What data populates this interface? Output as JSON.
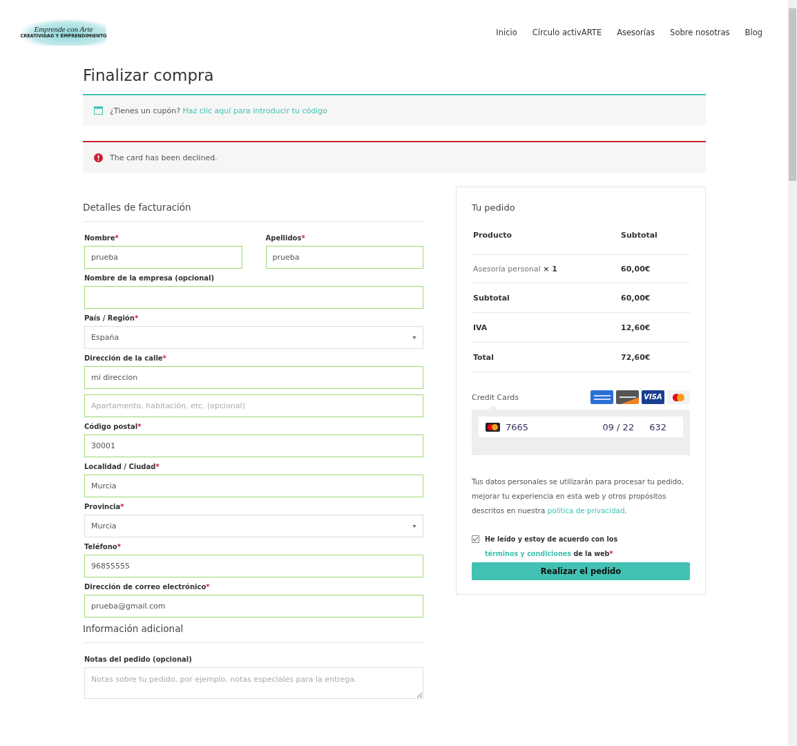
{
  "logo": {
    "script": "Emprende con Arte",
    "tagline": "CREATIVIDAD Y EMPRENDIMIENTO"
  },
  "nav": [
    {
      "label": "Inicio"
    },
    {
      "label": "Círculo activARTE"
    },
    {
      "label": "Asesorías"
    },
    {
      "label": "Sobre nosotras"
    },
    {
      "label": "Blog"
    }
  ],
  "page_title": "Finalizar compra",
  "notices": [
    {
      "kind": "info",
      "text": "¿Tienes un cupón?",
      "link": "Haz clic aquí para introducir tu código"
    },
    {
      "kind": "error",
      "text": "The card has been declined."
    }
  ],
  "billing": {
    "title": "Detalles de facturación",
    "rows": [
      [
        {
          "kind": "text",
          "label": "Nombre",
          "required_mark": "*",
          "value": "prueba"
        },
        {
          "kind": "text",
          "label": "Apellidos",
          "required_mark": "*",
          "value": "prueba"
        }
      ],
      [
        {
          "kind": "text",
          "label": "Nombre de la empresa (opcional)"
        }
      ],
      [
        {
          "kind": "select",
          "label": "País / Región",
          "required_mark": "*",
          "value": "España"
        }
      ],
      [
        {
          "kind": "text",
          "label": "Dirección de la calle",
          "required_mark": "*",
          "value": "mi direccion"
        }
      ],
      [
        {
          "kind": "text",
          "placeholder": "Apartamento, habitación, etc. (opcional)"
        }
      ],
      [
        {
          "kind": "text",
          "label": "Código postal",
          "required_mark": "*",
          "value": "30001"
        }
      ],
      [
        {
          "kind": "text",
          "label": "Localidad / Ciudad",
          "required_mark": "*",
          "value": "Murcia"
        }
      ],
      [
        {
          "kind": "select",
          "label": "Provincia",
          "required_mark": "*",
          "value": "Murcia"
        }
      ],
      [
        {
          "kind": "text",
          "label": "Teléfono",
          "required_mark": "*",
          "value": "96855555"
        }
      ],
      [
        {
          "kind": "text",
          "label": "Dirección de correo electrónico",
          "required_mark": "*",
          "value": "prueba@gmail.com"
        }
      ]
    ]
  },
  "additional": {
    "title": "Información adicional",
    "rows": [
      [
        {
          "kind": "textarea",
          "label": "Notas del pedido (opcional)",
          "placeholder": "Notas sobre tu pedido, por ejemplo, notas especiales para la entrega."
        }
      ]
    ]
  },
  "order": {
    "title": "Tu pedido",
    "columns": [
      "Producto",
      "Subtotal"
    ],
    "item": {
      "name": "Asesoría personal",
      "qty": "× 1",
      "subtotal": "60,00€"
    },
    "totals": [
      {
        "label": "Subtotal",
        "value": "60,00€"
      },
      {
        "label": "IVA",
        "value": "12,60€"
      },
      {
        "label": "Total",
        "value": "72,60€"
      }
    ],
    "payment": {
      "title": "Credit Cards",
      "brands": [
        {
          "kind": "amex"
        },
        {
          "kind": "discover"
        },
        {
          "kind": "visa",
          "label": "VISA"
        },
        {
          "kind": "mastercard"
        }
      ],
      "card_number": "7665",
      "expiry": "09 / 22",
      "cvc": "632"
    },
    "privacy": {
      "text": "Tus datos personales se utilizarán para procesar tu pedido, mejorar tu experiencia en esta web y otros propósitos descritos en nuestra",
      "link": "política de privacidad",
      "end": "."
    },
    "terms": {
      "checked": true,
      "text": "He leído y estoy de acuerdo con los",
      "link": "términos y condiciones",
      "end": "de la web",
      "required_mark": "*"
    },
    "button": "Realizar el pedido"
  }
}
